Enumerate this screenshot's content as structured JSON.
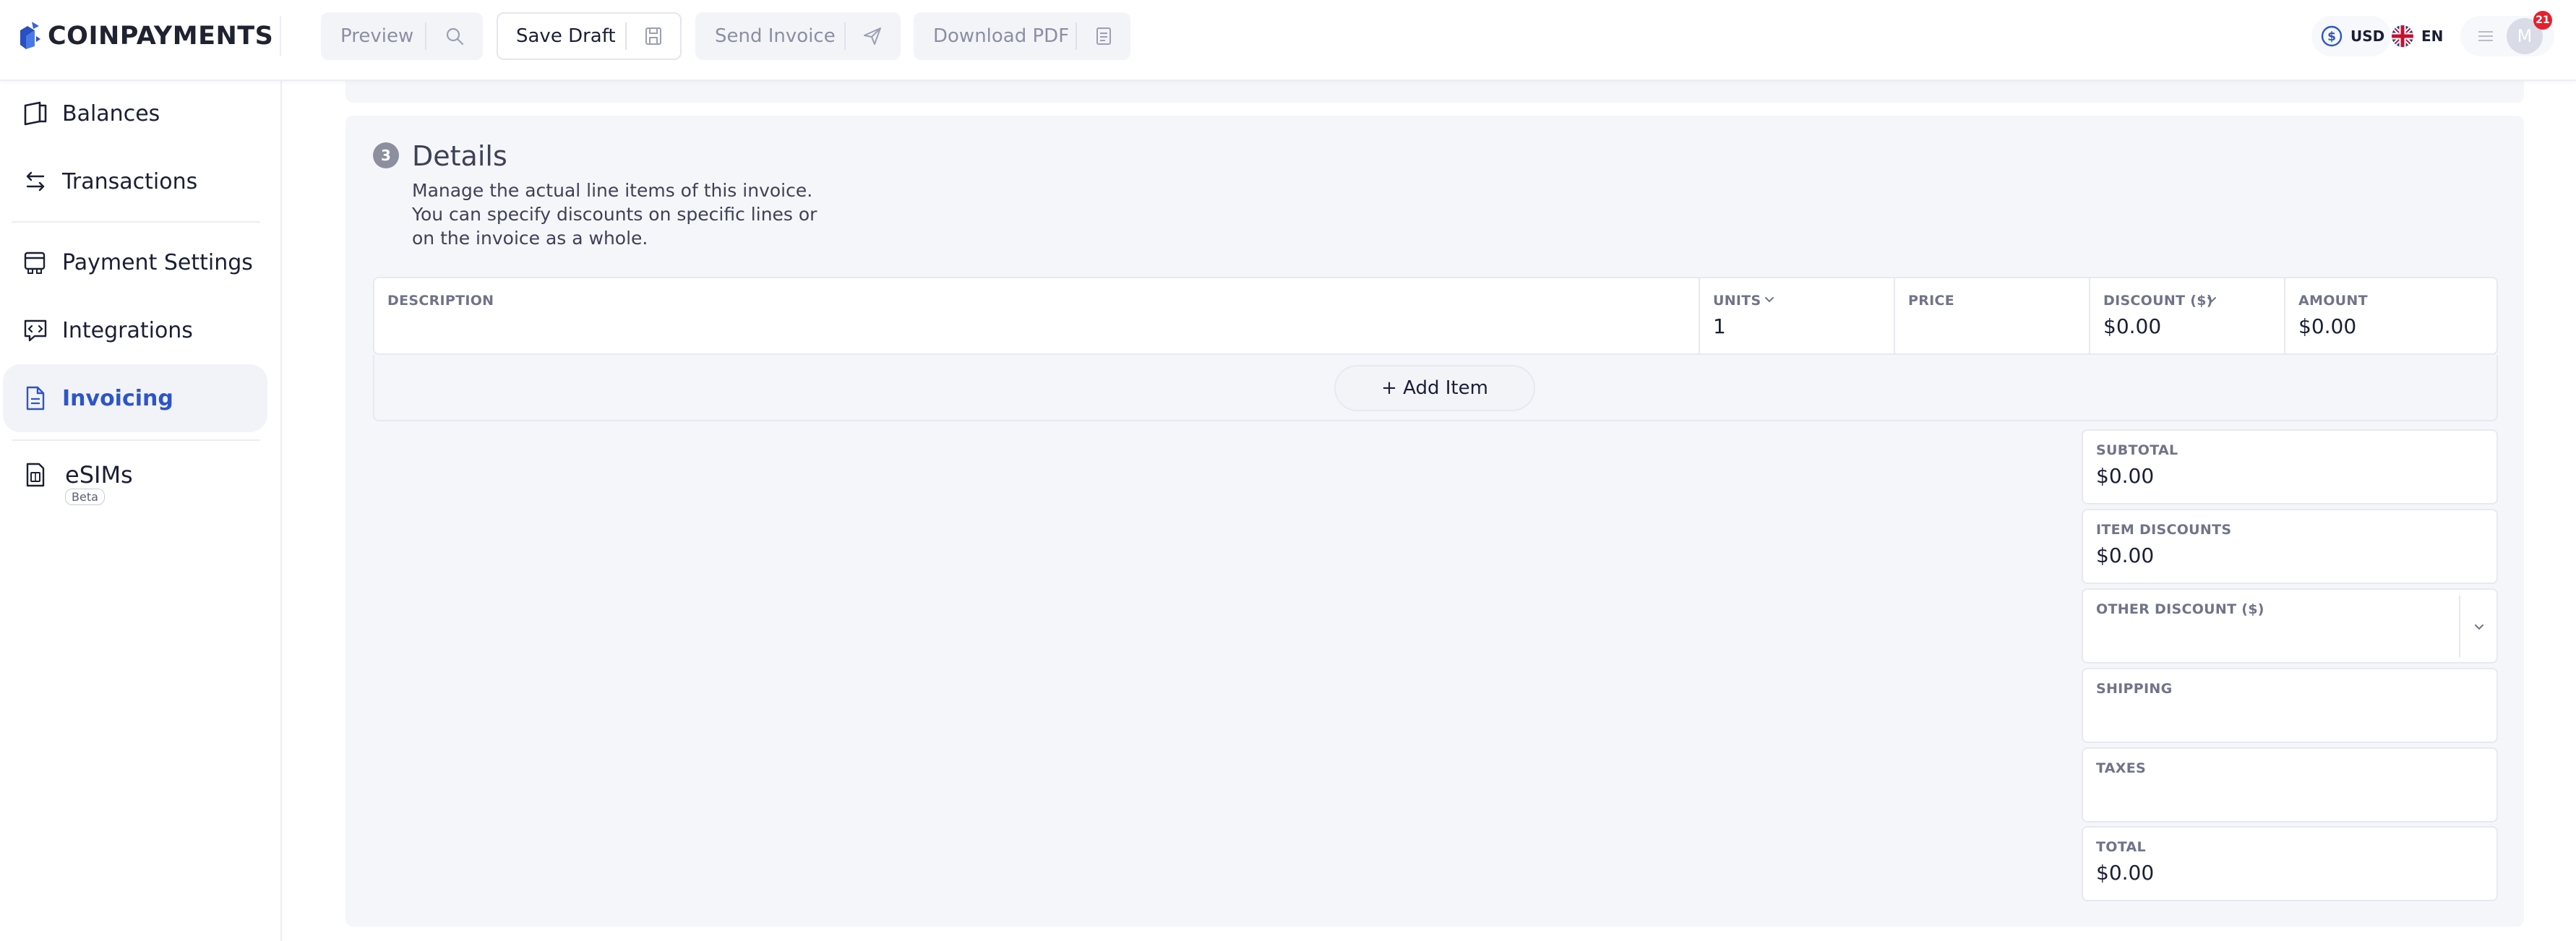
{
  "brand": {
    "name": "COINPAYMENTS"
  },
  "toolbar": {
    "preview": "Preview",
    "save_draft": "Save Draft",
    "send_invoice": "Send Invoice",
    "download_pdf": "Download PDF"
  },
  "header": {
    "currency": "USD",
    "language": "EN",
    "avatar_initial": "M",
    "notification_count": "21"
  },
  "sidebar": {
    "items": [
      {
        "label": "Balances",
        "icon": "wallet-icon"
      },
      {
        "label": "Transactions",
        "icon": "transfer-arrows-icon"
      },
      {
        "label": "Payment Settings",
        "icon": "payment-settings-icon"
      },
      {
        "label": "Integrations",
        "icon": "integrations-icon"
      },
      {
        "label": "Invoicing",
        "icon": "document-icon",
        "active": true
      },
      {
        "label": "eSIMs",
        "icon": "esim-icon",
        "badge": "Beta"
      }
    ]
  },
  "details": {
    "step": "3",
    "title": "Details",
    "description": "Manage the actual line items of this invoice. You can specify discounts on specific lines or on the invoice as a whole.",
    "columns": {
      "description": "DESCRIPTION",
      "units": "UNITS",
      "price": "PRICE",
      "discount": "DISCOUNT ($)",
      "amount": "AMOUNT"
    },
    "row": {
      "description": "",
      "units": "1",
      "price": "",
      "discount": "$0.00",
      "amount": "$0.00"
    },
    "add_item": "+ Add Item",
    "summary": {
      "subtotal_label": "SUBTOTAL",
      "subtotal": "$0.00",
      "item_discounts_label": "ITEM DISCOUNTS",
      "item_discounts": "$0.00",
      "other_discount_label": "OTHER DISCOUNT ($)",
      "other_discount": "",
      "shipping_label": "SHIPPING",
      "shipping": "",
      "taxes_label": "TAXES",
      "taxes": "",
      "total_label": "TOTAL",
      "total": "$0.00"
    }
  },
  "colors": {
    "accent": "#2c55c8",
    "panel": "#f5f6fa",
    "notification": "#e5202e"
  }
}
